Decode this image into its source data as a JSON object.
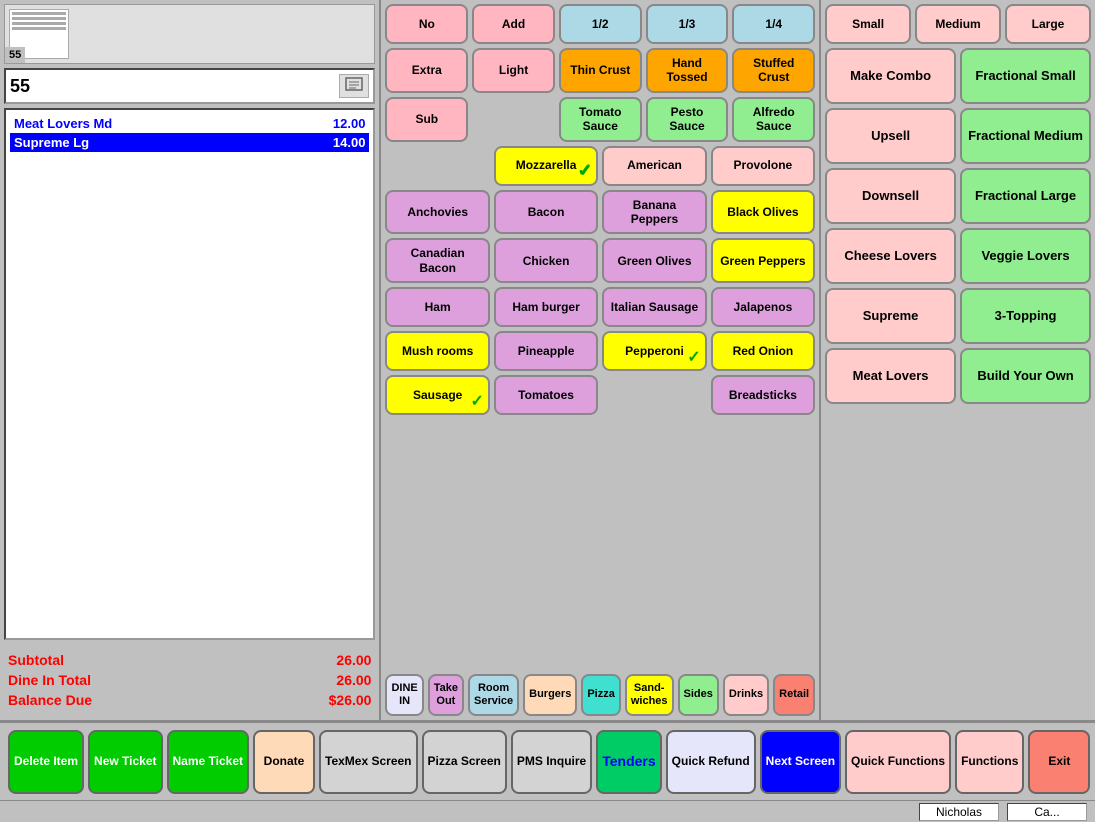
{
  "ticket": {
    "number": "55",
    "input_value": "55"
  },
  "order_items": [
    {
      "name": "Meat Lovers Md",
      "price": "12.00",
      "highlighted": false
    },
    {
      "name": "Supreme Lg",
      "price": "14.00",
      "highlighted": true
    }
  ],
  "totals": {
    "subtotal_label": "Subtotal",
    "subtotal_value": "26.00",
    "dine_in_label": "Dine In Total",
    "dine_in_value": "26.00",
    "balance_label": "Balance Due",
    "balance_value": "$26.00"
  },
  "modifiers": {
    "row1": [
      "No",
      "Add",
      "1/2",
      "1/3",
      "1/4"
    ],
    "row2": [
      "Extra",
      "Light",
      "Thin Crust",
      "Hand Tossed",
      "Stuffed Crust"
    ],
    "row3": [
      "Sub",
      "",
      "Tomato Sauce",
      "Pesto Sauce",
      "Alfredo Sauce"
    ]
  },
  "cheese": {
    "mozzarella": "Mozzarella",
    "american": "American",
    "provolone": "Provolone"
  },
  "toppings": [
    {
      "name": "Anchovies",
      "checked": false,
      "color": "purple-light"
    },
    {
      "name": "Bacon",
      "checked": false,
      "color": "purple-light"
    },
    {
      "name": "Banana Peppers",
      "checked": false,
      "color": "purple-light"
    },
    {
      "name": "Black Olives",
      "checked": false,
      "color": "yellow"
    },
    {
      "name": "Canadian Bacon",
      "checked": false,
      "color": "purple-light"
    },
    {
      "name": "Chicken",
      "checked": false,
      "color": "purple-light"
    },
    {
      "name": "Green Olives",
      "checked": false,
      "color": "purple-light"
    },
    {
      "name": "Green Peppers",
      "checked": false,
      "color": "yellow"
    },
    {
      "name": "Ham",
      "checked": false,
      "color": "purple-light"
    },
    {
      "name": "Ham burger",
      "checked": false,
      "color": "purple-light"
    },
    {
      "name": "Italian Sausage",
      "checked": false,
      "color": "purple-light"
    },
    {
      "name": "Jalapenos",
      "checked": false,
      "color": "purple-light"
    },
    {
      "name": "Mush rooms",
      "checked": false,
      "color": "yellow"
    },
    {
      "name": "Pineapple",
      "checked": false,
      "color": "purple-light"
    },
    {
      "name": "Pepperoni",
      "checked": true,
      "color": "yellow"
    },
    {
      "name": "Red Onion",
      "checked": false,
      "color": "yellow"
    },
    {
      "name": "Sausage",
      "checked": true,
      "color": "yellow"
    },
    {
      "name": "Tomatoes",
      "checked": false,
      "color": "purple-light"
    },
    {
      "name": "",
      "checked": false,
      "color": "white"
    },
    {
      "name": "Breadsticks",
      "checked": false,
      "color": "purple-light"
    }
  ],
  "categories": [
    {
      "name": "DINE IN",
      "color": "lavender"
    },
    {
      "name": "Take Out",
      "color": "purple-light"
    },
    {
      "name": "Room Service",
      "color": "blue-light"
    },
    {
      "name": "Burgers",
      "color": "peach"
    },
    {
      "name": "Pizza",
      "color": "teal"
    },
    {
      "name": "Sand-wiches",
      "color": "yellow"
    },
    {
      "name": "Sides",
      "color": "green-light"
    },
    {
      "name": "Drinks",
      "color": "pink-light"
    },
    {
      "name": "Retail",
      "color": "salmon"
    }
  ],
  "sizes": {
    "small": "Small",
    "medium": "Medium",
    "large": "Large",
    "fractional_small": "Fractional Small",
    "fractional_medium": "Fractional Medium",
    "fractional_large": "Fractional Large"
  },
  "right_buttons": {
    "make_combo": "Make Combo",
    "upsell": "Upsell",
    "downsell": "Downsell",
    "cheese_lovers": "Cheese Lovers",
    "veggie_lovers": "Veggie Lovers",
    "supreme": "Supreme",
    "three_topping": "3-Topping",
    "meat_lovers": "Meat Lovers",
    "build_your_own": "Build Your Own"
  },
  "toolbar": {
    "delete_item": "Delete Item",
    "new_ticket": "New Ticket",
    "name_ticket": "Name Ticket",
    "donate": "Donate",
    "texmex_screen": "TexMex Screen",
    "pizza_screen": "Pizza Screen",
    "pms_inquire": "PMS Inquire",
    "tenders": "Tenders",
    "quick_refund": "Quick Refund",
    "next_screen": "Next Screen",
    "quick_functions": "Quick Functions",
    "functions": "Functions",
    "exit": "Exit"
  },
  "status_bar": {
    "user": "Nicholas",
    "cashier": "Ca..."
  }
}
